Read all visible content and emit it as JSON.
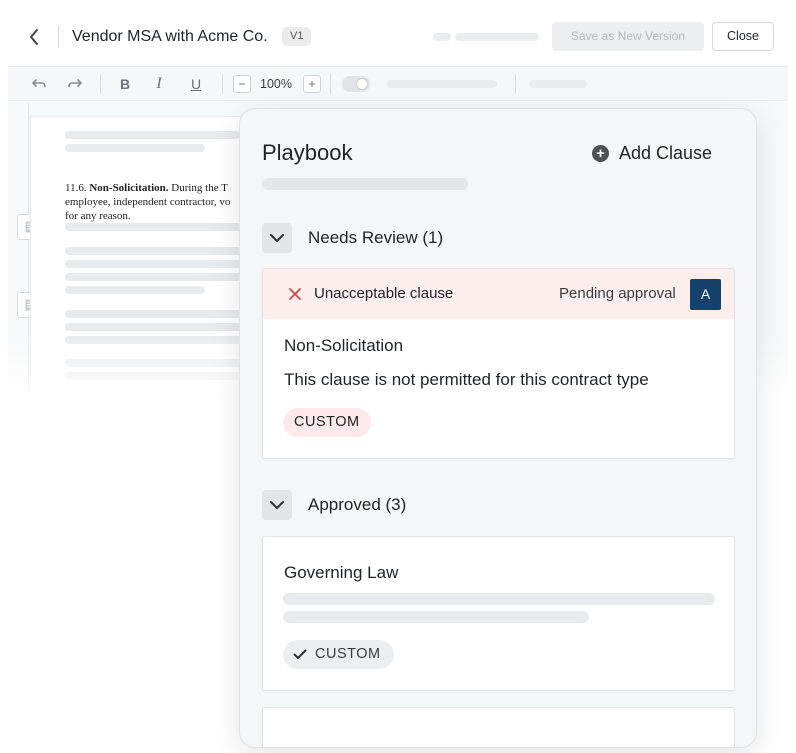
{
  "header": {
    "back_icon": "chevron-left-icon",
    "document_title": "Vendor MSA with Acme Co.",
    "version_badge": "V1",
    "save_button": "Save as New Version",
    "close_button": "Close"
  },
  "toolbar": {
    "undo_icon": "undo-icon",
    "redo_icon": "redo-icon",
    "bold_label": "B",
    "italic_label": "I",
    "underline_label": "U",
    "zoom_out_label": "−",
    "zoom_level": "100%",
    "zoom_in_label": "+"
  },
  "document": {
    "clause_number": "11.6.",
    "clause_heading": "Non-Solicitation.",
    "clause_line_1": "During the T",
    "clause_line_2": "employee, independent contractor, vo",
    "clause_line_3": "for any reason."
  },
  "playbook": {
    "title": "Playbook",
    "add_clause_label": "Add Clause",
    "groups": [
      {
        "label": "Needs Review (1)",
        "cards": [
          {
            "alert_label": "Unacceptable clause",
            "status": "Pending approval",
            "avatar_initial": "A",
            "title": "Non-Solicitation",
            "description": "This clause is not permitted for this contract type",
            "tag": "CUSTOM"
          }
        ]
      },
      {
        "label": "Approved (3)",
        "cards": [
          {
            "title": "Governing Law",
            "tag": "CUSTOM"
          }
        ]
      }
    ]
  },
  "colors": {
    "alert_background": "#fdeeee",
    "alert_icon": "#d64545",
    "avatar_background": "#15416b",
    "panel_background": "#f5f6f7"
  }
}
